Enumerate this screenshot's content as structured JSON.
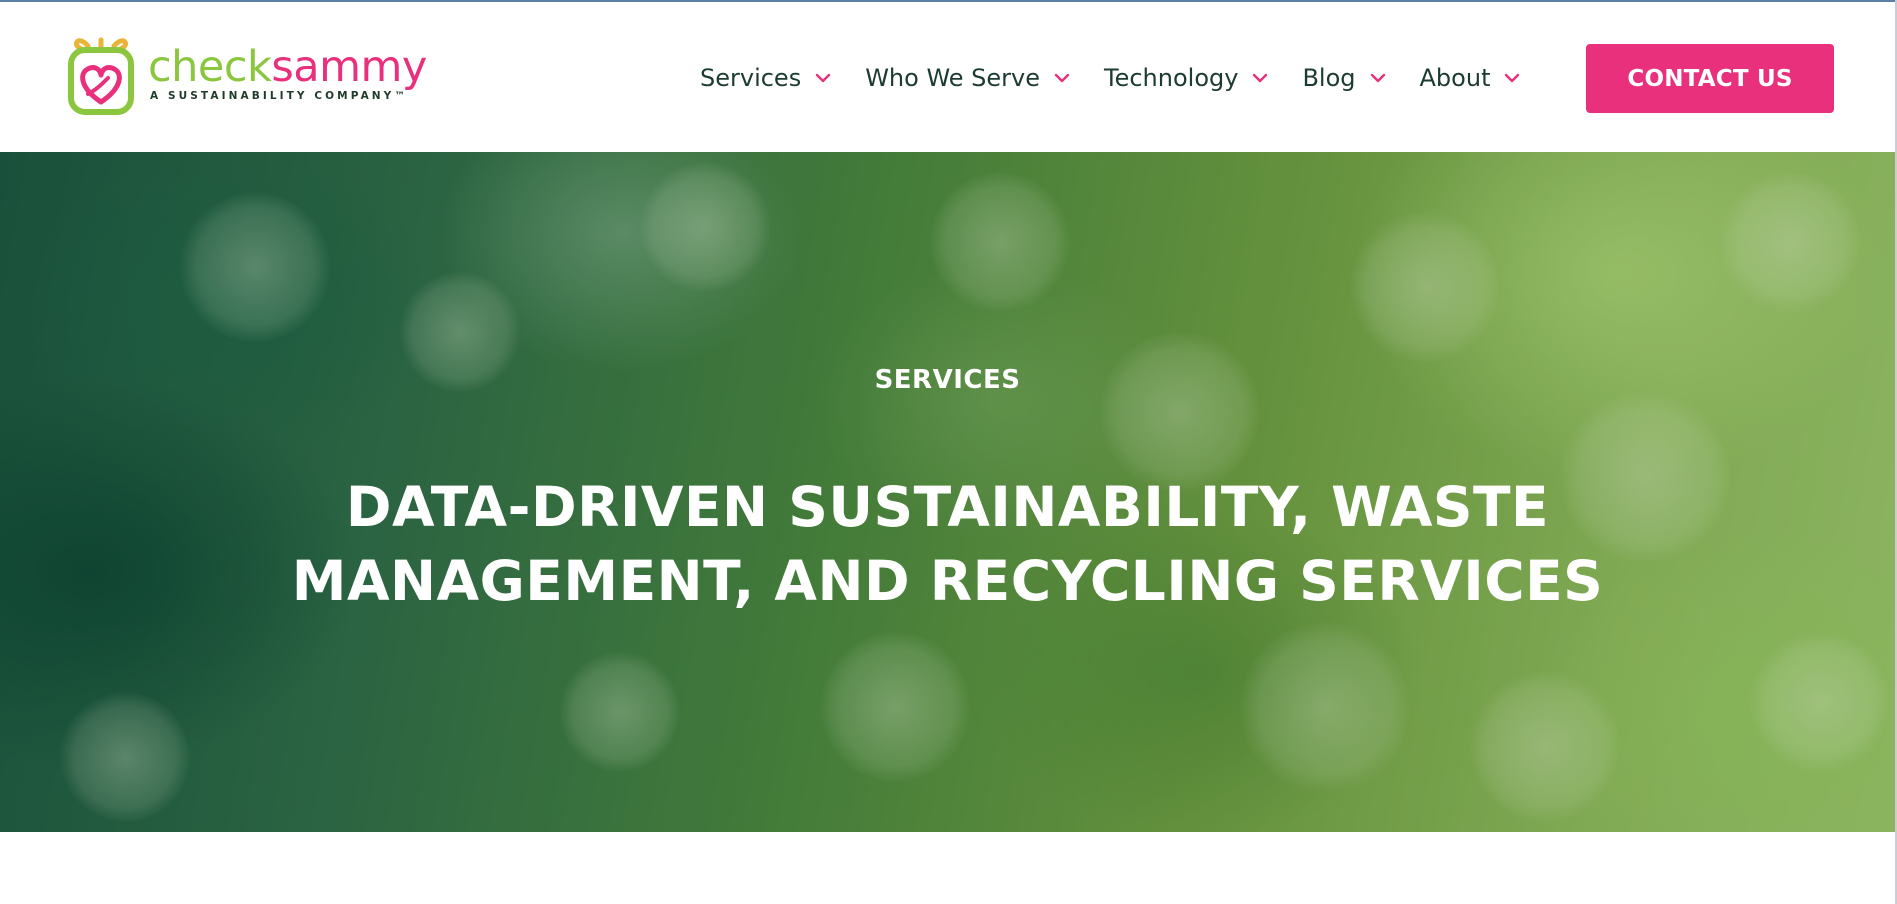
{
  "brand": {
    "name_part1": "check",
    "name_part2": "sammy",
    "tagline": "A SUSTAINABILITY COMPANY™",
    "colors": {
      "green": "#8cc63f",
      "pink": "#e8307d",
      "gold": "#e8b53a",
      "dark_text": "#1c3b33"
    }
  },
  "nav": {
    "items": [
      {
        "label": "Services",
        "icon": "chevron-down-icon"
      },
      {
        "label": "Who We Serve",
        "icon": "chevron-down-icon"
      },
      {
        "label": "Technology",
        "icon": "chevron-down-icon"
      },
      {
        "label": "Blog",
        "icon": "chevron-down-icon"
      },
      {
        "label": "About",
        "icon": "chevron-down-icon"
      }
    ],
    "cta_label": "CONTACT US"
  },
  "hero": {
    "eyebrow": "SERVICES",
    "title_line1": "DATA-DRIVEN SUSTAINABILITY, WASTE",
    "title_line2": "MANAGEMENT, AND RECYCLING SERVICES",
    "background": "blurred green foliage bokeh"
  }
}
